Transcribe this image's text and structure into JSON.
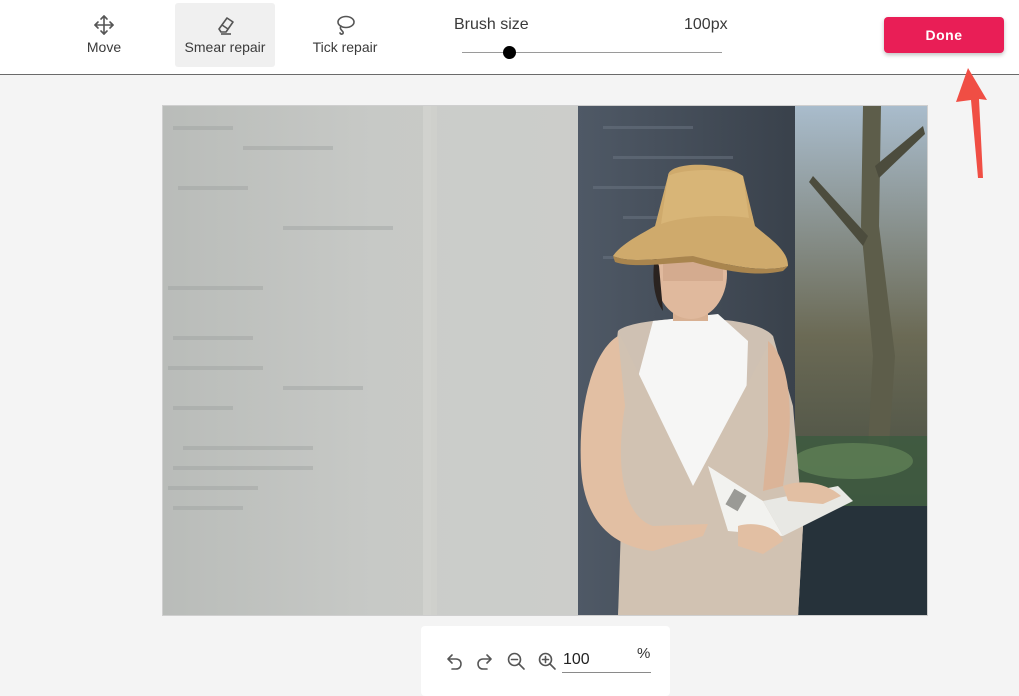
{
  "toolbar": {
    "tools": [
      {
        "label": "Move",
        "icon": "move-icon",
        "active": false
      },
      {
        "label": "Smear repair",
        "icon": "eraser-icon",
        "active": true
      },
      {
        "label": "Tick repair",
        "icon": "lasso-icon",
        "active": false
      }
    ],
    "brush": {
      "label": "Brush size",
      "value_text": "100px",
      "level_fraction": 0.18
    },
    "done_label": "Done"
  },
  "annotation": {
    "arrow_color": "#f04e44"
  },
  "canvas": {
    "description_icon": "photo-image"
  },
  "zoom_controls": {
    "undo_icon": "undo-icon",
    "redo_icon": "redo-icon",
    "zoom_out_icon": "zoom-out-icon",
    "zoom_in_icon": "zoom-in-icon",
    "zoom_value": "100",
    "zoom_unit": "%"
  },
  "colors": {
    "accent": "#e91e56",
    "background": "#f4f4f4",
    "toolbar": "#ffffff"
  }
}
